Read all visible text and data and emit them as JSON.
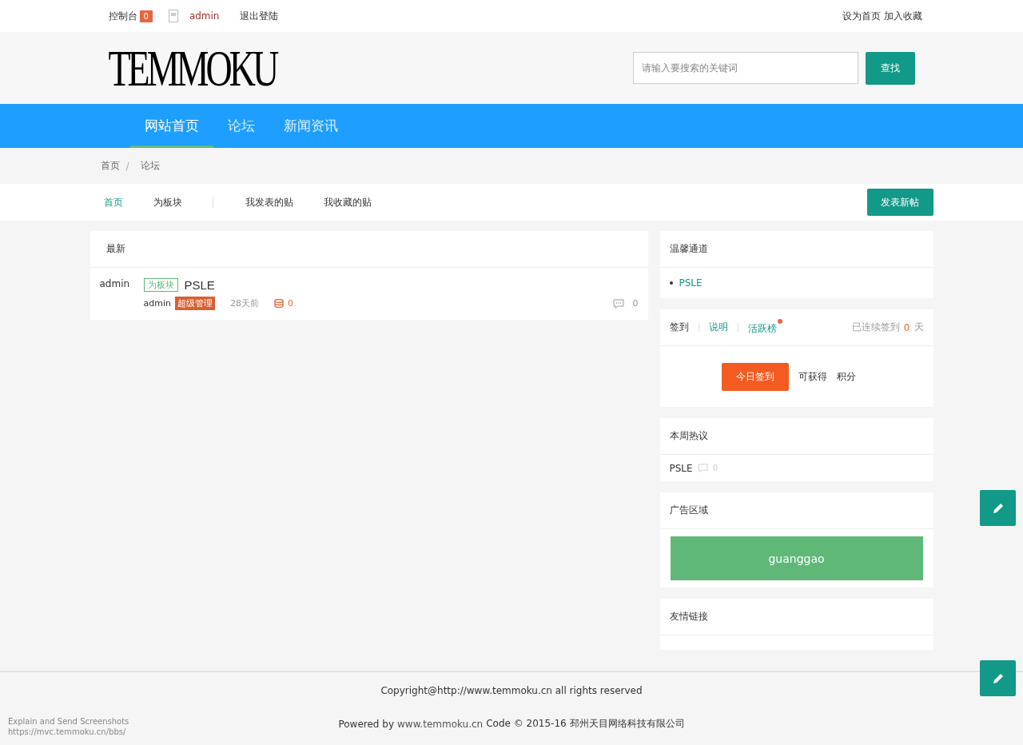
{
  "top_bar": {
    "console_label": "控制台",
    "console_count": "0",
    "username": "admin",
    "logout": "退出登陆",
    "links": [
      "设为首页",
      "加入收藏"
    ]
  },
  "logo": "TEMMOKU",
  "search": {
    "placeholder": "请输入要搜索的关键词",
    "button": "查找"
  },
  "nav": [
    {
      "label": "网站首页",
      "selected": true
    },
    {
      "label": "论坛",
      "selected": false
    },
    {
      "label": "新闻资讯",
      "selected": false
    }
  ],
  "breadcrumb": {
    "separator": "/",
    "items": [
      "首页",
      "论坛"
    ]
  },
  "subnav": {
    "items": [
      {
        "label": "首页",
        "selected": true
      },
      {
        "label": "为板块",
        "selected": false
      },
      {
        "label": "我发表的贴",
        "selected": false
      },
      {
        "label": "我收藏的贴",
        "selected": false
      }
    ],
    "new_post_button": "发表新帖"
  },
  "posts": {
    "heading": "最新",
    "items": [
      {
        "author": "admin",
        "tag": "为板块",
        "title": "PSLE",
        "meta_author": "admin",
        "role_badge": "超级管理",
        "time": "28天前",
        "coins": "0",
        "replies": "0"
      }
    ]
  },
  "sidebar": {
    "channels": {
      "title": "温馨通道",
      "items": [
        "PSLE"
      ]
    },
    "signin": {
      "tabs": [
        {
          "label": "签到",
          "kind": "plain",
          "dot": false
        },
        {
          "label": "说明",
          "kind": "link",
          "dot": false
        },
        {
          "label": "活跃榜",
          "kind": "link",
          "dot": true
        }
      ],
      "streak_label": "已连续签到",
      "streak_days": "0",
      "streak_unit": "天",
      "button": "今日签到",
      "reward": "可获得",
      "reward_unit": "积分"
    },
    "hot": {
      "title": "本周热议",
      "items": [
        {
          "title": "PSLE",
          "replies": "0"
        }
      ]
    },
    "ad": {
      "title": "广告区域",
      "banner": "guanggao"
    },
    "links": {
      "title": "友情链接"
    }
  },
  "footer": {
    "copyright": "Copyright@http://www.temmoku.cn all rights reserved",
    "powered_prefix": "Powered by",
    "powered_link": "www.temmoku.cn",
    "powered_suffix": "Code © 2015-16 邳州天目网络科技有限公司"
  },
  "overlay": [
    "Explain and Send Screenshots",
    "https://mvc.temmoku.cn/bbs/"
  ]
}
